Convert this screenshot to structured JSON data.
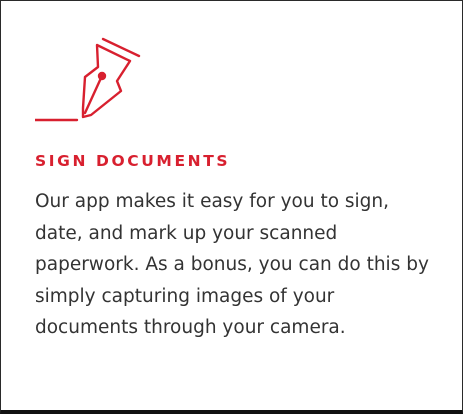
{
  "feature": {
    "icon": "pen-nib-icon",
    "accent_color": "#d8202f",
    "heading": "SIGN DOCUMENTS",
    "description": "Our app makes it easy for you to sign, date, and mark up your scanned paperwork. As a bonus, you can do this by simply capturing images of your documents through your camera."
  }
}
